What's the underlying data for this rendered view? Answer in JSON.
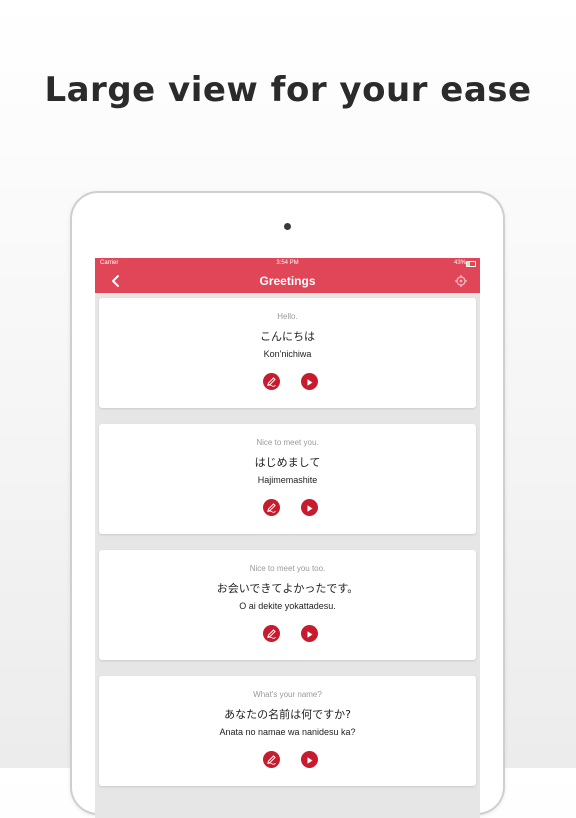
{
  "headline": "Large view for your ease",
  "status_bar": {
    "carrier": "Carrier",
    "time": "3:54 PM",
    "battery": "43%"
  },
  "nav": {
    "title": "Greetings"
  },
  "phrases": [
    {
      "english": "Hello.",
      "japanese": "こんにちは",
      "romaji": "Kon'nichiwa"
    },
    {
      "english": "Nice to meet you.",
      "japanese": "はじめまして",
      "romaji": "Hajimemashite"
    },
    {
      "english": "Nice to meet you too.",
      "japanese": "お会いできてよかったです。",
      "romaji": "O ai dekite yokattadesu."
    },
    {
      "english": "What's your name?",
      "japanese": "あなたの名前は何ですか?",
      "romaji": "Anata no namae wa nanidesu ka?"
    }
  ],
  "colors": {
    "accent": "#e04558",
    "button": "#c81c2e"
  },
  "icons": {
    "back": "chevron-left-icon",
    "settings": "gear-icon",
    "write": "pencil-icon",
    "play": "play-icon"
  }
}
